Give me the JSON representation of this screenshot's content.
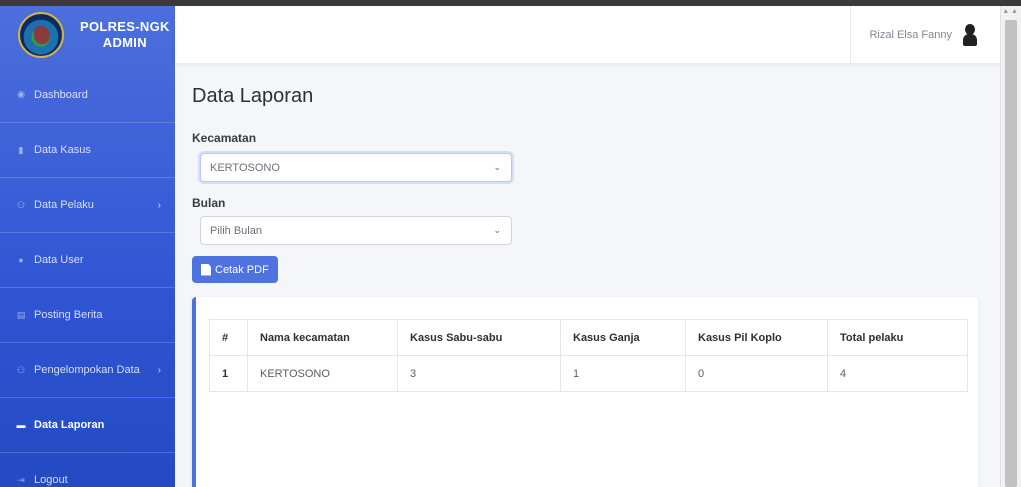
{
  "brand": {
    "line1": "POLRES-NGK",
    "line2": "ADMIN"
  },
  "sidebar": {
    "items": [
      {
        "label": "Dashboard",
        "icon": "dashboard-icon"
      },
      {
        "label": "Data Kasus",
        "icon": "file-icon"
      },
      {
        "label": "Data Pelaku",
        "icon": "users-icon",
        "has_chevron": true
      },
      {
        "label": "Data User",
        "icon": "user-icon"
      },
      {
        "label": "Posting Berita",
        "icon": "newspaper-icon"
      },
      {
        "label": "Pengelompokan Data",
        "icon": "users-icon",
        "has_chevron": true
      },
      {
        "label": "Data Laporan",
        "icon": "report-icon",
        "active": true
      },
      {
        "label": "Logout",
        "icon": "logout-icon"
      }
    ],
    "chevron": "›"
  },
  "topbar": {
    "user_name": "Rizal Elsa Fanny"
  },
  "page": {
    "title": "Data Laporan",
    "kecamatan_label": "Kecamatan",
    "kecamatan_value": "KERTOSONO",
    "bulan_label": "Bulan",
    "bulan_value": "Pilih Bulan",
    "pdf_button": "Cetak PDF"
  },
  "table": {
    "headers": [
      "#",
      "Nama kecamatan",
      "Kasus Sabu-sabu",
      "Kasus Ganja",
      "Kasus Pil Koplo",
      "Total pelaku"
    ],
    "rows": [
      [
        "1",
        "KERTOSONO",
        "3",
        "1",
        "0",
        "4"
      ]
    ]
  },
  "colors": {
    "sidebar": "#4e73df",
    "accent": "#4e73df"
  }
}
